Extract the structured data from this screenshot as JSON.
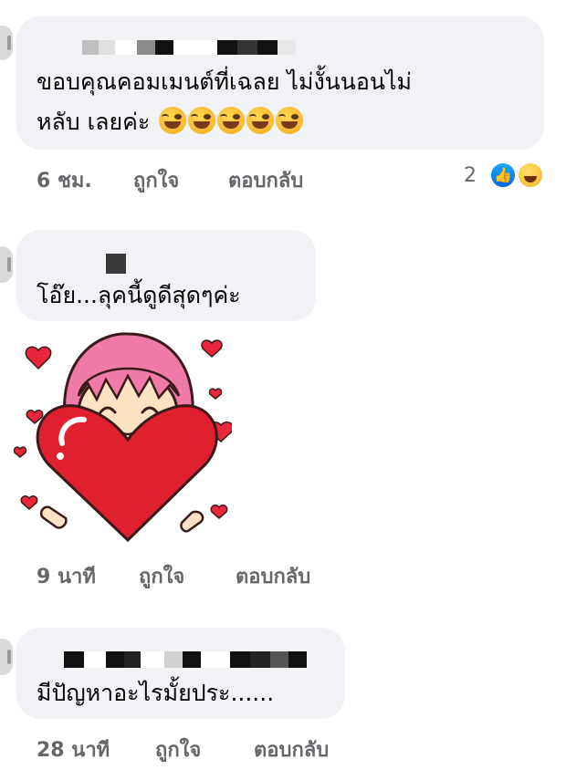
{
  "comments": [
    {
      "text_line1": "ขอบคุณคอมเมนต์ที่เฉลย ไม่งั้นนอนไม่",
      "text_line2": "หลับ เลยค่ะ",
      "time": "6 ชม.",
      "like_label": "ถูกใจ",
      "reply_label": "ตอบกลับ",
      "reaction_count": "2",
      "reactions": [
        "like-icon",
        "haha-icon"
      ],
      "emoji": [
        "rofl-emoji",
        "rofl-emoji",
        "rofl-emoji",
        "rofl-emoji",
        "rofl-emoji"
      ]
    },
    {
      "text": "โอ๊ย...ลุคนี้ดูดีสุดๆค่ะ",
      "sticker": "girl-holding-heart-sticker",
      "time": "9 นาที",
      "like_label": "ถูกใจ",
      "reply_label": "ตอบกลับ"
    },
    {
      "text": "มีปัญหาอะไรมั้ยประ......",
      "time": "28 นาที",
      "like_label": "ถูกใจ",
      "reply_label": "ตอบกลับ"
    }
  ],
  "colors": {
    "bubble": "#f0f2f5",
    "meta_text": "#65676b",
    "like_blue": "#1877f2"
  }
}
